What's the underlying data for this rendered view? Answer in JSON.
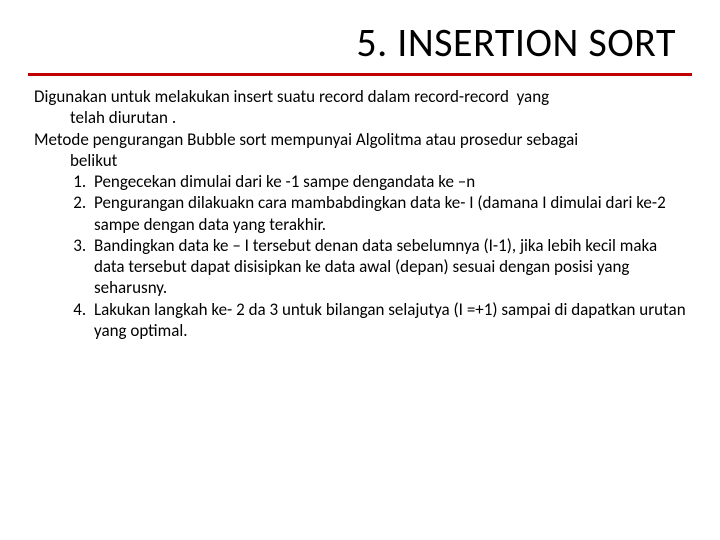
{
  "title": "5. INSERTION SORT",
  "intro1": "Digunakan untuk melakukan insert suatu record dalam record-record  yang telah diurutan .",
  "intro2": "Metode pengurangan Bubble sort mempunyai Algolitma atau prosedur sebagai belikut",
  "items": [
    "Pengecekan dimulai dari ke -1 sampe dengandata ke –n",
    "Pengurangan dilakuakn cara mambabdingkan data ke- I (damana I dimulai dari ke-2 sampe dengan data yang terakhir.",
    "Bandingkan data ke – I tersebut denan data sebelumnya (I-1), jika lebih kecil maka data tersebut dapat disisipkan ke data awal (depan) sesuai dengan posisi yang seharusny.",
    "Lakukan langkah  ke- 2 da 3 untuk bilangan selajutya (I =+1) sampai di dapatkan urutan yang optimal."
  ]
}
